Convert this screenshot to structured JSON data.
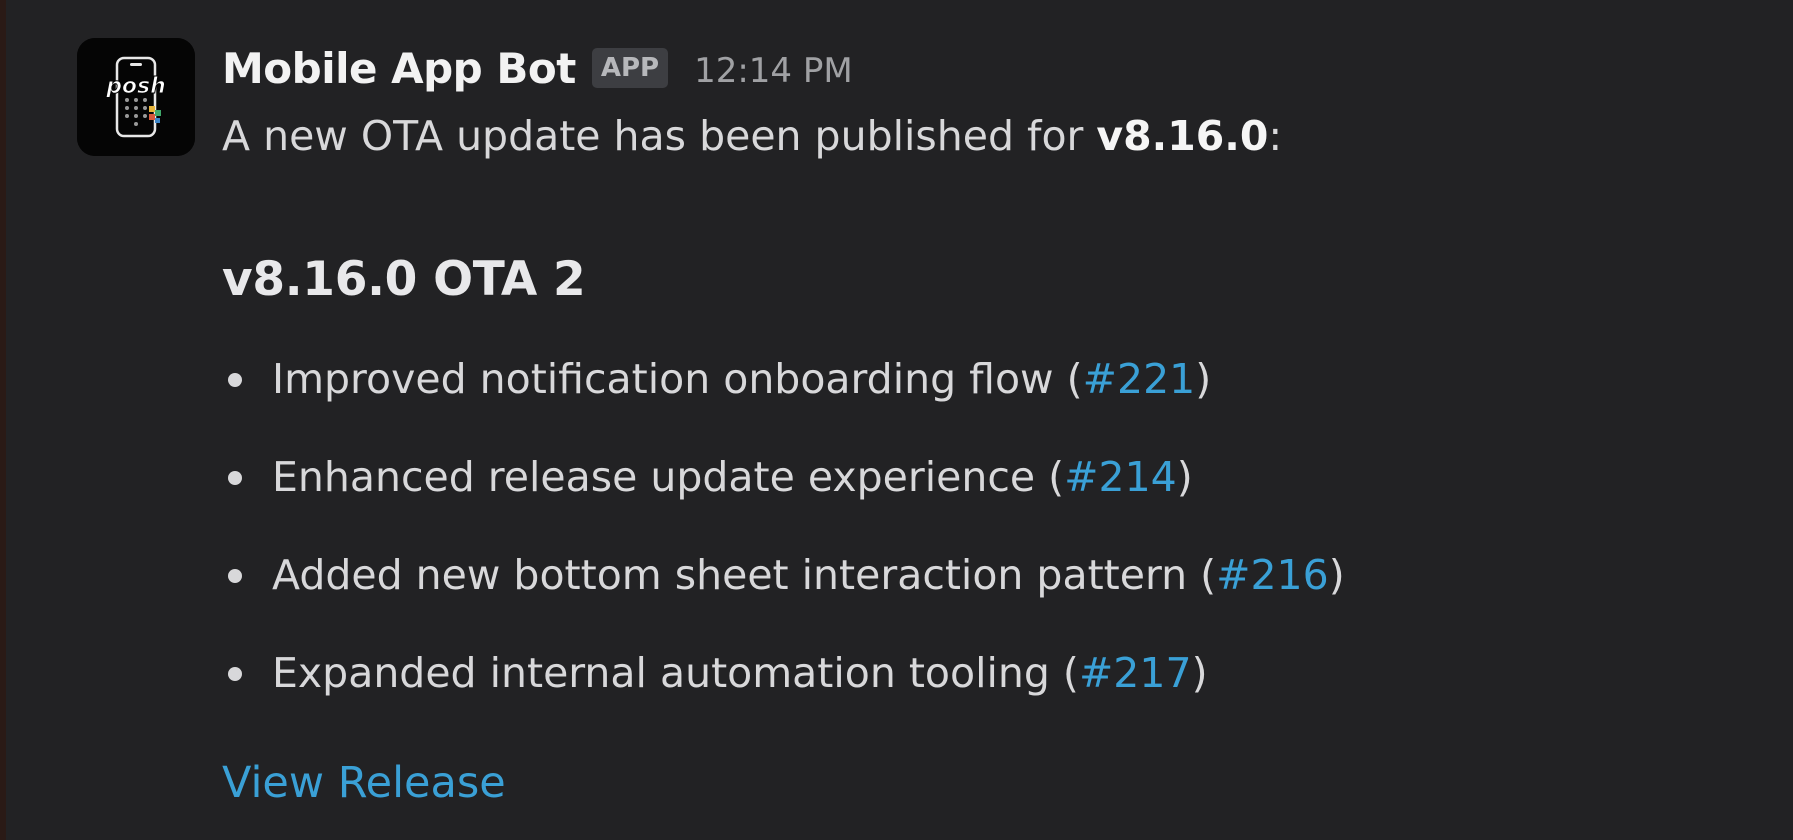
{
  "message": {
    "avatar": {
      "logo_text": "posh",
      "icon": "phone-app-icon"
    },
    "bot_name": "Mobile App Bot",
    "badge": "APP",
    "timestamp": "12:14 PM",
    "intro_prefix": "A new OTA update has been published for ",
    "intro_version": "v8.16.0",
    "intro_suffix": ":",
    "release_title": "v8.16.0 OTA 2",
    "changes": [
      {
        "text": "Improved notification onboarding flow (",
        "pr": "#221",
        "close": ")"
      },
      {
        "text": "Enhanced release update experience (",
        "pr": "#214",
        "close": ")"
      },
      {
        "text": "Added new bottom sheet interaction pattern (",
        "pr": "#216",
        "close": ")"
      },
      {
        "text": "Expanded internal automation tooling (",
        "pr": "#217",
        "close": ")"
      }
    ],
    "view_release_label": "View Release"
  },
  "colors": {
    "background": "#222224",
    "link": "#3aa0d6",
    "name": "#f2f2f2",
    "text": "#d8d8da"
  }
}
